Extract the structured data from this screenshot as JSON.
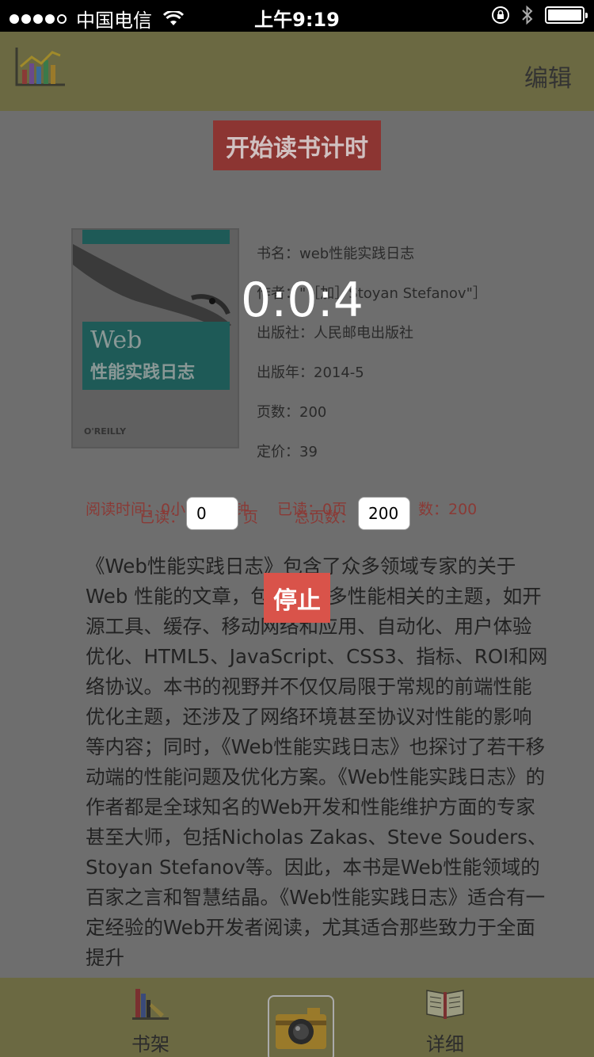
{
  "status_bar": {
    "carrier": "中国电信",
    "time": "上午9:19",
    "signal_bars_filled": 4,
    "signal_bars_total": 5
  },
  "nav": {
    "edit_label": "编辑",
    "chart_icon": "chart-icon"
  },
  "actions": {
    "start_timer_label": "开始读书计时",
    "stop_label": "停止"
  },
  "timer": {
    "display": "0:0:4"
  },
  "book": {
    "cover_web": "Web",
    "cover_title": "性能实践日志",
    "cover_publisher_mark": "O'REILLY",
    "title_row": "书名：web性能实践日志",
    "author_row": "作者：\"［加］Stoyan Stefanov\"］",
    "publisher_row": "出版社：人民邮电出版社",
    "year_row": "出版年：2014-5",
    "pages_row": "页数：200",
    "price_row": "定价：39"
  },
  "stats": {
    "read_time_label": "阅读时间：0小",
    "read_time_tail": "钟",
    "read_pages_label": "已读：0页",
    "total_tail": "数：200",
    "read_input_label": "已读：",
    "read_input_value": "0",
    "page_unit": "页",
    "total_input_label": "总页数：",
    "total_input_value": "200"
  },
  "description": "《Web性能实践日志》包含了众多领域专家的关于 Web 性能的文章，包括了许多性能相关的主题，如开源工具、缓存、移动网络和应用、自动化、用户体验优化、HTML5、JavaScript、CSS3、指标、ROI和网络协议。本书的视野并不仅仅局限于常规的前端性能优化主题，还涉及了网络环境甚至协议对性能的影响等内容；同时，《Web性能实践日志》也探讨了若干移动端的性能问题及优化方案。《Web性能实践日志》的作者都是全球知名的Web开发和性能维护方面的专家甚至大师，包括Nicholas Zakas、Steve Souders、Stoyan Stefanov等。因此，本书是Web性能领域的百家之言和智慧结晶。《Web性能实践日志》适合有一定经验的Web开发者阅读，尤其适合那些致力于全面提升",
  "tabs": {
    "shelf_label": "书架",
    "detail_label": "详细"
  },
  "colors": {
    "nav_bg": "#6b6942",
    "start_button": "#8c3532",
    "stop_button": "#d9534a",
    "stats_text": "#8a3a36"
  }
}
